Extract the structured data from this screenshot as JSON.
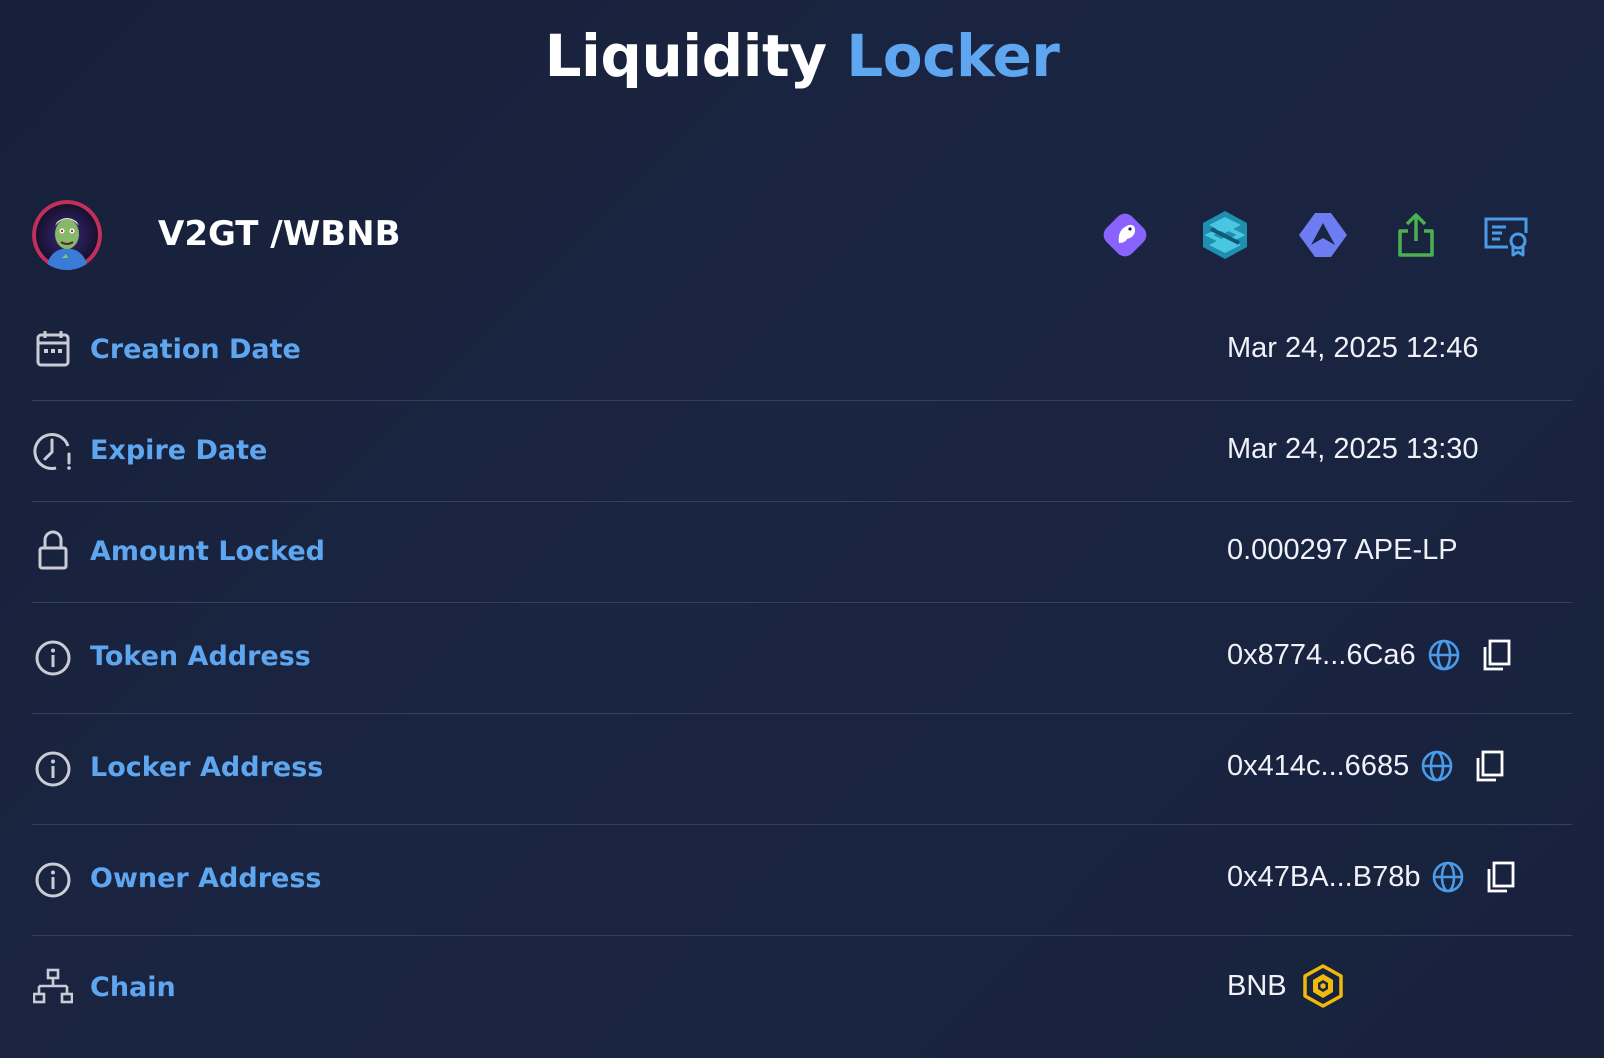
{
  "header": {
    "title_part1": "Liquidity",
    "title_part2": "Locker"
  },
  "pair": {
    "name": "V2GT /WBNB",
    "external_links": [
      {
        "icon": "dexview-icon",
        "color": "#8a63ff"
      },
      {
        "icon": "dextools-icon",
        "color": "#2fb1c8"
      },
      {
        "icon": "dexscreener-icon",
        "color": "#6d7cf0"
      },
      {
        "icon": "share-icon",
        "color": "#4caf50"
      },
      {
        "icon": "certificate-icon",
        "color": "#4a9be8"
      }
    ]
  },
  "details": {
    "creation_date": {
      "label": "Creation Date",
      "value": "Mar 24, 2025 12:46",
      "icon": "calendar-icon"
    },
    "expire_date": {
      "label": "Expire Date",
      "value": "Mar 24, 2025 13:30",
      "icon": "clock-alert-icon"
    },
    "amount_locked": {
      "label": "Amount Locked",
      "value": "0.000297 APE-LP",
      "icon": "lock-icon"
    },
    "token_address": {
      "label": "Token Address",
      "value": "0x8774...6Ca6",
      "icon": "info-icon"
    },
    "locker_address": {
      "label": "Locker Address",
      "value": "0x414c...6685",
      "icon": "info-icon"
    },
    "owner_address": {
      "label": "Owner Address",
      "value": "0x47BA...B78b",
      "icon": "info-icon"
    },
    "chain": {
      "label": "Chain",
      "value": "BNB",
      "icon": "network-icon",
      "logo": "bnb-logo-icon",
      "logo_color": "#f0b90b"
    }
  },
  "colors": {
    "accent": "#5ea6f0",
    "background": "#1a2542",
    "divider": "#334060",
    "icon_gray": "#c9ccd4"
  }
}
